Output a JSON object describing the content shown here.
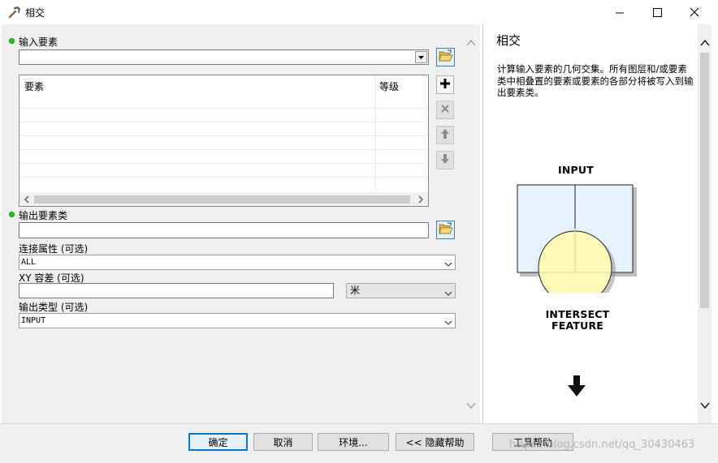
{
  "window": {
    "title": "相交"
  },
  "form": {
    "input_features_label": "输入要素",
    "grid_col_features": "要素",
    "grid_col_rank": "等级",
    "output_class_label": "输出要素类",
    "join_attr_label": "连接属性 (可选)",
    "join_attr_value": "ALL",
    "xy_tol_label": "XY 容差 (可选)",
    "xy_unit_value": "米",
    "output_type_label": "输出类型 (可选)",
    "output_type_value": "INPUT"
  },
  "help": {
    "title": "相交",
    "description": "计算输入要素的几何交集。所有图层和/或要素类中相叠置的要素或要素的各部分将被写入到输出要素类。",
    "diagram_top_label": "INPUT",
    "diagram_bottom_label": "INTERSECT\nFEATURE"
  },
  "buttons": {
    "ok": "确定",
    "cancel": "取消",
    "env": "环境...",
    "hide_help": "<< 隐藏帮助",
    "tool_help": "工具帮助"
  },
  "watermark": "https://blog.csdn.net/qq_30430463",
  "colors": {
    "required_dot": "#22c322",
    "default_button_border": "#0078d7",
    "input_polygon": "#e6f2fc",
    "intersect_circle": "#fefbb8"
  },
  "icons": [
    "hammer-icon",
    "minimize-icon",
    "maximize-icon",
    "close-icon",
    "folder-open-icon",
    "add-icon",
    "delete-icon",
    "move-up-icon",
    "move-down-icon",
    "chevron-down-icon",
    "scroll-up-arrow-icon",
    "scroll-down-arrow-icon",
    "down-arrow-icon"
  ]
}
